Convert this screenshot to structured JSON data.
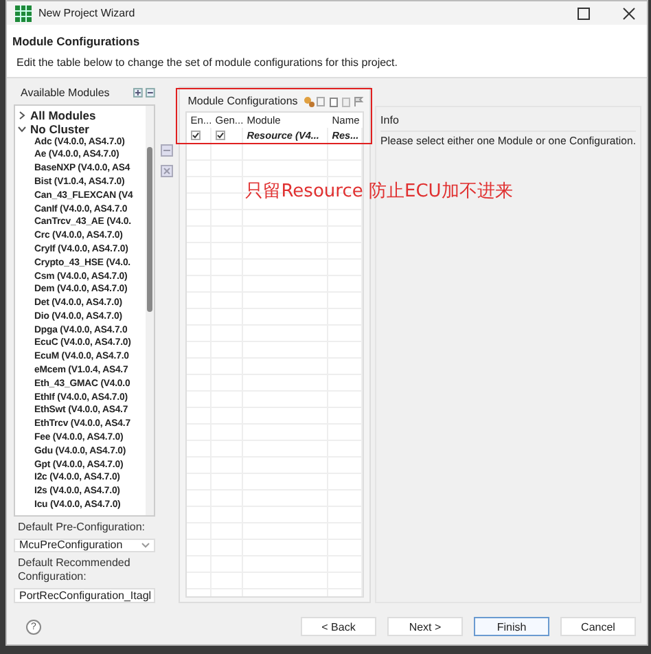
{
  "window": {
    "title": "New Project Wizard"
  },
  "header": {
    "title": "Module Configurations",
    "description": "Edit the table below to change the set of module configurations for this project."
  },
  "available_modules": {
    "title": "Available Modules",
    "tree": [
      {
        "label": "All Modules",
        "expanded": false
      },
      {
        "label": "No Cluster",
        "expanded": true,
        "children": [
          {
            "label": "Adc (V4.0.0, AS4.7.0)"
          },
          {
            "label": "Ae (V4.0.0, AS4.7.0)"
          },
          {
            "label": "BaseNXP (V4.0.0, AS4"
          },
          {
            "label": "Bist (V1.0.4, AS4.7.0)"
          },
          {
            "label": "Can_43_FLEXCAN (V4"
          },
          {
            "label": "CanIf (V4.0.0, AS4.7.0"
          },
          {
            "label": "CanTrcv_43_AE (V4.0."
          },
          {
            "label": "Crc (V4.0.0, AS4.7.0)"
          },
          {
            "label": "CryIf (V4.0.0, AS4.7.0)"
          },
          {
            "label": "Crypto_43_HSE (V4.0."
          },
          {
            "label": "Csm (V4.0.0, AS4.7.0)"
          },
          {
            "label": "Dem (V4.0.0, AS4.7.0)"
          },
          {
            "label": "Det (V4.0.0, AS4.7.0)"
          },
          {
            "label": "Dio (V4.0.0, AS4.7.0)"
          },
          {
            "label": "Dpga (V4.0.0, AS4.7.0"
          },
          {
            "label": "EcuC (V4.0.0, AS4.7.0)"
          },
          {
            "label": "EcuM (V4.0.0, AS4.7.0"
          },
          {
            "label": "eMcem (V1.0.4, AS4.7"
          },
          {
            "label": "Eth_43_GMAC (V4.0.0"
          },
          {
            "label": "EthIf (V4.0.0, AS4.7.0)"
          },
          {
            "label": "EthSwt (V4.0.0, AS4.7"
          },
          {
            "label": "EthTrcv (V4.0.0, AS4.7"
          },
          {
            "label": "Fee (V4.0.0, AS4.7.0)"
          },
          {
            "label": "Gdu (V4.0.0, AS4.7.0)"
          },
          {
            "label": "Gpt (V4.0.0, AS4.7.0)"
          },
          {
            "label": "I2c (V4.0.0, AS4.7.0)"
          },
          {
            "label": "I2s (V4.0.0, AS4.7.0)"
          },
          {
            "label": "Icu (V4.0.0, AS4.7.0)"
          }
        ]
      }
    ]
  },
  "default_pre_configuration": {
    "label": "Default Pre-Configuration:",
    "value": "McuPreConfiguration"
  },
  "default_recommended_configuration": {
    "label": "Default Recommended Configuration:",
    "value": "PortRecConfiguration_Itagl"
  },
  "module_configurations": {
    "title": "Module Configurations",
    "columns": [
      "En...",
      "Gen...",
      "Module",
      "Name"
    ],
    "rows": [
      {
        "enabled": true,
        "generate": true,
        "module": "Resource (V4...",
        "name": "Res..."
      }
    ]
  },
  "annotation": {
    "text": "只留Resource 防止ECU加不进来"
  },
  "info": {
    "title": "Info",
    "message": "Please select either one Module or one Configuration."
  },
  "help_button": {
    "label": "?"
  },
  "buttons": [
    {
      "label": "< Back",
      "default": false
    },
    {
      "label": "Next >",
      "default": false
    },
    {
      "label": "Finish",
      "default": true
    },
    {
      "label": "Cancel",
      "default": false
    }
  ]
}
